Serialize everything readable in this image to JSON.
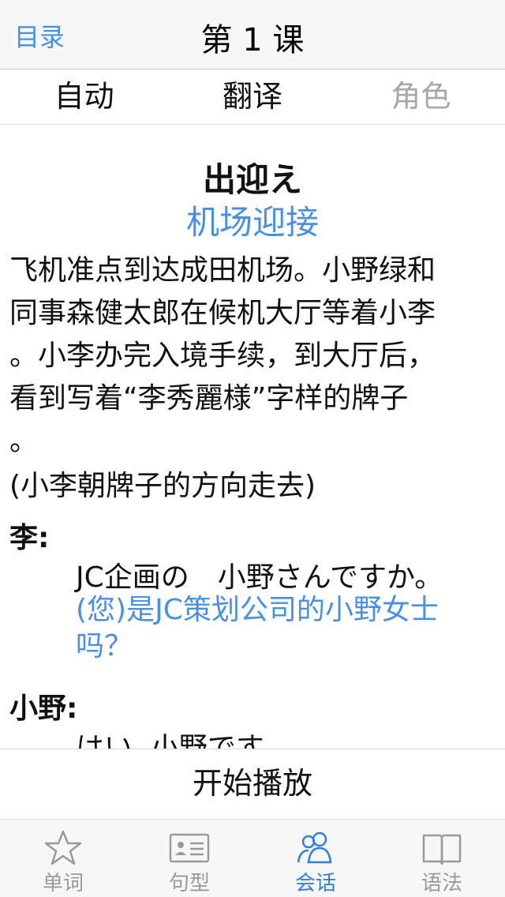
{
  "nav": {
    "back_label": "目录",
    "title": "第 1 课"
  },
  "segments": [
    {
      "label": "自动",
      "enabled": true
    },
    {
      "label": "翻译",
      "enabled": true
    },
    {
      "label": "角色",
      "enabled": false
    }
  ],
  "lesson": {
    "title": "出迎え",
    "subtitle": "机场迎接",
    "intro_lines": [
      "飞机准点到达成田机场。小野绿和",
      "同事森健太郎在候机大厅等着小李",
      "。小李办完入境手续，到大厅后，",
      "看到写着“李秀麗様”字样的牌子",
      "。"
    ],
    "action": "(小李朝牌子的方向走去)",
    "dialogue": [
      {
        "speaker": "李:",
        "ja": "JC企画の　小野さんですか。",
        "cn_lines": [
          "(您)是JC策划公司的小野女士",
          "吗？"
        ]
      },
      {
        "speaker": "小野:",
        "ja": "はい, 小野です。",
        "cn_lines": []
      }
    ]
  },
  "play_button": {
    "label": "开始播放"
  },
  "tabs": [
    {
      "label": "单词",
      "icon": "star-icon",
      "active": false
    },
    {
      "label": "句型",
      "icon": "card-icon",
      "active": false
    },
    {
      "label": "会话",
      "icon": "people-icon",
      "active": true
    },
    {
      "label": "语法",
      "icon": "book-icon",
      "active": false
    }
  ],
  "colors": {
    "accent": "#4a90e2",
    "tab_active": "#2f7fe0",
    "tab_inactive": "#9a9a9a"
  }
}
